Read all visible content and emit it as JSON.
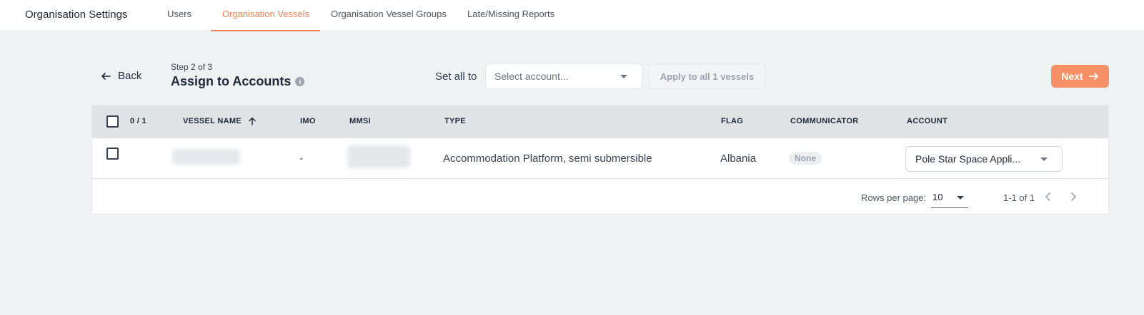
{
  "topnav": {
    "title": "Organisation Settings",
    "tabs": [
      {
        "label": "Users",
        "active": false
      },
      {
        "label": "Organisation Vessels",
        "active": true
      },
      {
        "label": "Organisation Vessel Groups",
        "active": false
      },
      {
        "label": "Late/Missing Reports",
        "active": false
      }
    ]
  },
  "header": {
    "back_label": "Back",
    "step_label": "Step 2 of 3",
    "step_title": "Assign to Accounts",
    "set_all_label": "Set all to",
    "select_placeholder": "Select account...",
    "apply_label": "Apply to all 1 vessels",
    "next_label": "Next"
  },
  "table": {
    "selection_count": "0 / 1",
    "columns": [
      "VESSEL NAME",
      "IMO",
      "MMSI",
      "TYPE",
      "FLAG",
      "COMMUNICATOR",
      "ACCOUNT"
    ],
    "rows": [
      {
        "imo": "-",
        "type": "Accommodation Platform, semi submersible",
        "flag": "Albania",
        "communicator": "None",
        "account": "Pole Star Space Appli..."
      }
    ],
    "footer": {
      "rows_per_page_label": "Rows per page:",
      "rows_per_page": "10",
      "page_info": "1-1 of 1"
    }
  },
  "colors": {
    "accent": "#f0845c",
    "next_button": "#f79067",
    "header_bg": "#dfe3e6",
    "page_bg": "#eef2f3"
  }
}
